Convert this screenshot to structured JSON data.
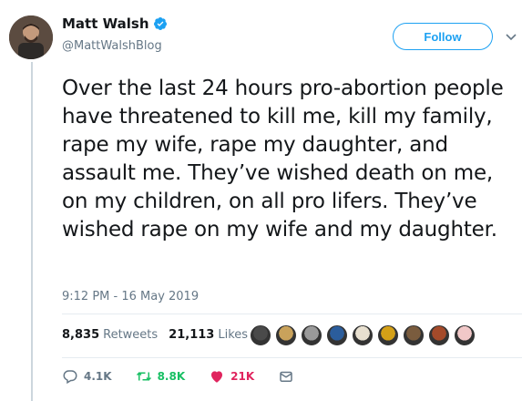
{
  "user": {
    "display_name": "Matt Walsh",
    "handle": "@MattWalshBlog",
    "verified": true
  },
  "follow_label": "Follow",
  "tweet": {
    "text": "Over the last 24 hours pro-abortion people have threatened to kill me, kill my family, rape my wife, rape my daughter, and assault me. They’ve wished death on me, on my children, on all pro lifers. They’ve wished rape on my wife and my daughter.",
    "timestamp": "9:12 PM - 16 May 2019"
  },
  "stats": {
    "retweets_count": "8,835",
    "retweets_label": "Retweets",
    "likes_count": "21,113",
    "likes_label": "Likes"
  },
  "liker_avatar_colors": [
    "#4a4a4a",
    "#c9a25b",
    "#9a9a9a",
    "#2b5d9c",
    "#e8e0d0",
    "#d4a017",
    "#7a5c3e",
    "#a44a2a",
    "#f1c8c8"
  ],
  "actions": {
    "replies": "4.1K",
    "retweets": "8.8K",
    "likes": "21K"
  },
  "colors": {
    "accent": "#1da1f2",
    "retweet_green": "#17bf63",
    "like_red": "#e0245e",
    "muted": "#657786"
  }
}
